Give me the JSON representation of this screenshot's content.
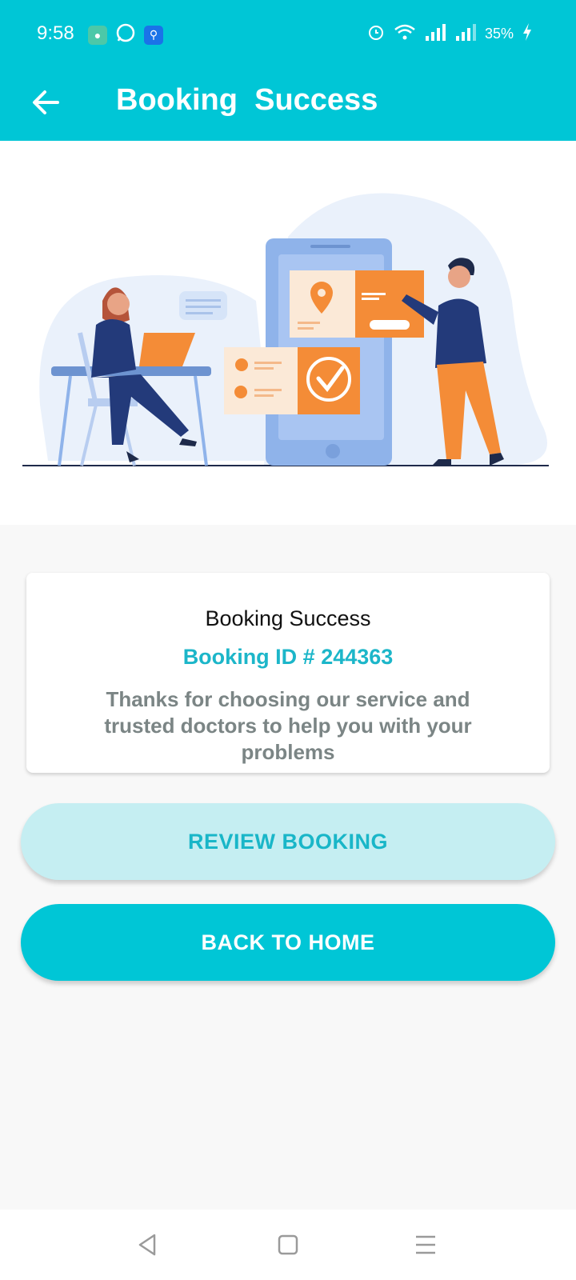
{
  "status_bar": {
    "time": "9:58",
    "battery": "35%",
    "icons": [
      "camera-app-icon",
      "whatsapp-icon",
      "usb-icon",
      "alarm-icon",
      "wifi-icon",
      "signal-icon",
      "signal-icon",
      "charging-icon"
    ]
  },
  "app_bar": {
    "title": "Booking  Success",
    "back_icon": "arrow-left-icon"
  },
  "illustration": {
    "subject": "booking-success-illustration"
  },
  "card": {
    "title": "Booking Success",
    "booking_id": "Booking ID # 244363",
    "message": "Thanks for choosing our service and trusted doctors to help you with your problems"
  },
  "buttons": {
    "review": "REVIEW BOOKING",
    "home": "BACK TO HOME"
  },
  "nav_bar": {
    "icons": [
      "back-triangle-icon",
      "home-square-icon",
      "menu-lines-icon"
    ]
  },
  "colors": {
    "primary": "#00c6d6",
    "accent_text": "#1cb6c9",
    "secondary_button": "#c5eef2"
  }
}
